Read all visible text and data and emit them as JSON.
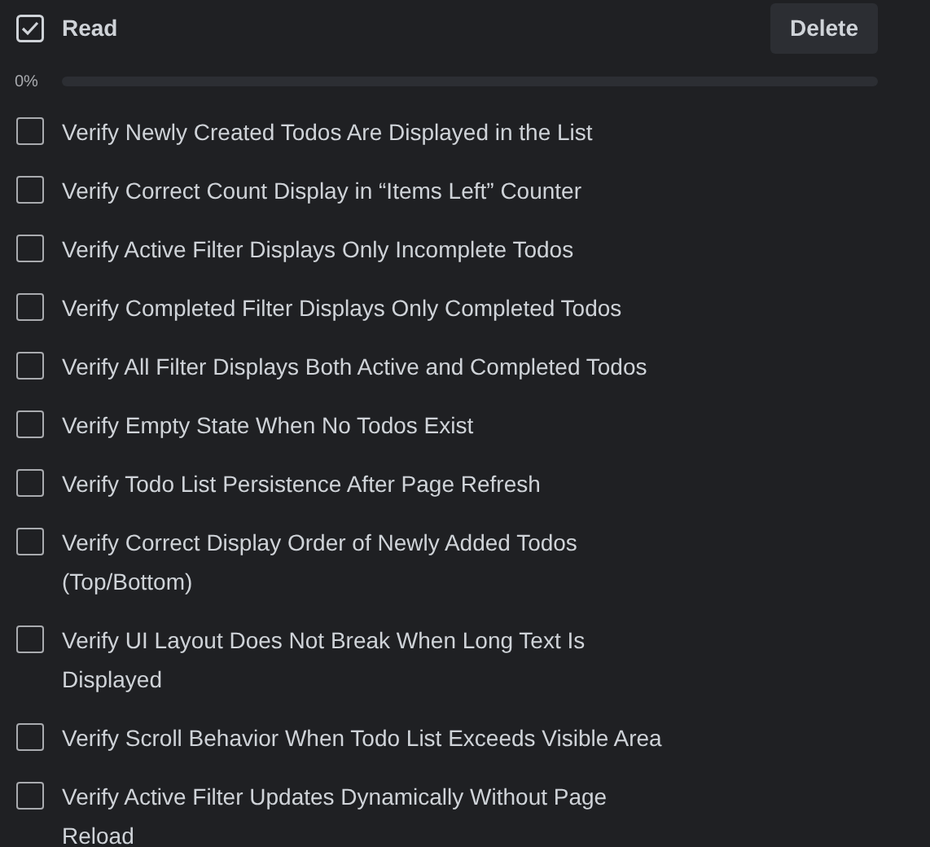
{
  "checklist": {
    "title": "Read",
    "delete_button": "Delete",
    "progress_label": "0%",
    "level": 0,
    "items": [
      {
        "text": "Verify Newly Created Todos Are Displayed in the List",
        "checked": false
      },
      {
        "text": "Verify Correct Count Display in “Items Left” Counter",
        "checked": false
      },
      {
        "text": "Verify Active Filter Displays Only Incomplete Todos",
        "checked": false
      },
      {
        "text": "Verify Completed Filter Displays Only Completed Todos",
        "checked": false
      },
      {
        "text": "Verify All Filter Displays Both Active and Completed Todos",
        "checked": false
      },
      {
        "text": "Verify Empty State When No Todos Exist",
        "checked": false
      },
      {
        "text": "Verify Todo List Persistence After Page Refresh",
        "checked": false
      },
      {
        "text": "Verify Correct Display Order of Newly Added Todos (Top/Bottom)",
        "checked": false
      },
      {
        "text": "Verify UI Layout Does Not Break When Long Text Is Displayed",
        "checked": false
      },
      {
        "text": "Verify Scroll Behavior When Todo List Exceeds Visible Area",
        "checked": false
      },
      {
        "text": "Verify Active Filter Updates Dynamically Without Page Reload",
        "checked": false
      }
    ]
  }
}
